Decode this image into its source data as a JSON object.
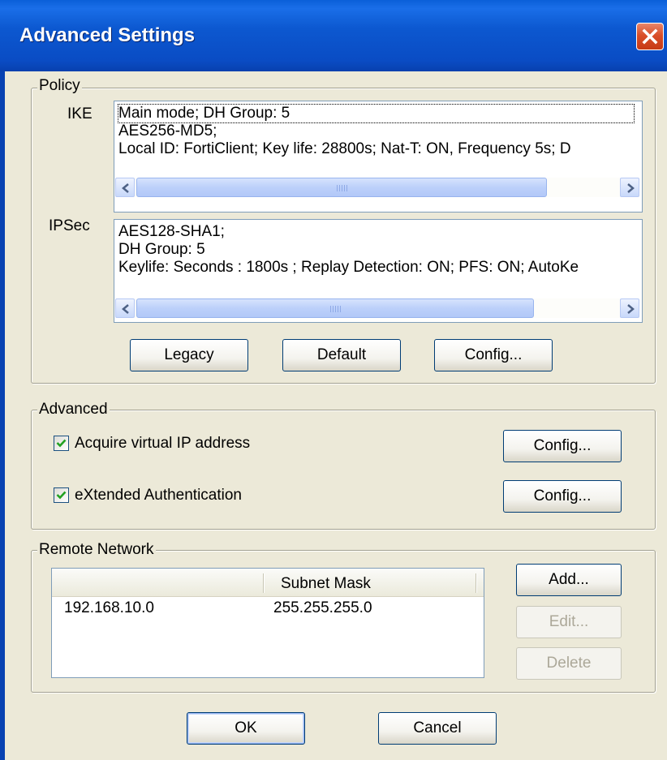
{
  "window": {
    "title": "Advanced Settings"
  },
  "policy": {
    "group_label": "Policy",
    "ike": {
      "label": "IKE",
      "lines": [
        "Main mode;  DH Group: 5",
        "AES256-MD5;",
        "Local ID: FortiClient;  Key life: 28800s;  Nat-T: ON, Frequency 5s;  D"
      ]
    },
    "ipsec": {
      "label": "IPSec",
      "lines": [
        "AES128-SHA1;",
        "DH Group: 5",
        "Keylife: Seconds : 1800s ; Replay Detection: ON; PFS: ON; AutoKe"
      ]
    },
    "buttons": {
      "legacy": "Legacy",
      "default": "Default",
      "config": "Config..."
    }
  },
  "advanced": {
    "group_label": "Advanced",
    "virtual_ip": {
      "label": "Acquire virtual IP address",
      "checked": true,
      "config": "Config..."
    },
    "xauth": {
      "label": "eXtended Authentication",
      "checked": true,
      "config": "Config..."
    }
  },
  "remote_network": {
    "group_label": "Remote Network",
    "columns": [
      "",
      "Subnet Mask"
    ],
    "rows": [
      {
        "address": "192.168.10.0",
        "mask": "255.255.255.0"
      }
    ],
    "buttons": {
      "add": "Add...",
      "edit": "Edit...",
      "delete": "Delete"
    }
  },
  "footer": {
    "ok": "OK",
    "cancel": "Cancel"
  }
}
